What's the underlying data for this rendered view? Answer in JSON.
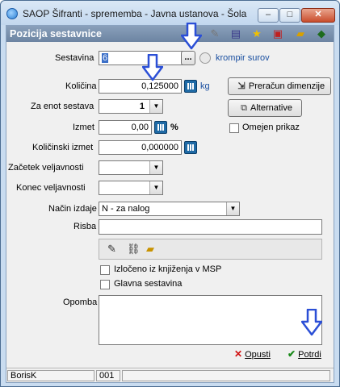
{
  "window": {
    "title": "SAOP Šifranti - sprememba - Javna ustanova - Šola",
    "min_symbol": "–",
    "max_symbol": "□",
    "close_symbol": "✕"
  },
  "header": {
    "title": "Pozicija sestavnice"
  },
  "form": {
    "sestavina_label": "Sestavina",
    "sestavina_value": "6",
    "sestavina_lookup": "...",
    "sestavina_name": "krompir surov",
    "kolicina_label": "Količina",
    "kolicina_value": "0,125000",
    "kolicina_unit": "kg",
    "za_enot_label": "Za enot sestava",
    "za_enot_value": "1",
    "izmet_label": "Izmet",
    "izmet_value": "0,00",
    "izmet_unit": "%",
    "kolicinski_izmet_label": "Količinski izmet",
    "kolicinski_izmet_value": "0,000000",
    "zacetek_label": "Začetek veljavnosti",
    "zacetek_value": "",
    "konec_label": "Konec veljavnosti",
    "konec_value": "",
    "nacin_label": "Način izdaje",
    "nacin_value": "N - za nalog",
    "risba_label": "Risba",
    "risba_value": "",
    "izloceno_label": "Izločeno iz knjiženja v MSP",
    "glavna_label": "Glavna sestavina",
    "opomba_label": "Opomba",
    "opomba_value": ""
  },
  "buttons": {
    "preracun": "Preračun dimenzije",
    "alternative": "Alternative",
    "omejen_prikaz": "Omejen prikaz",
    "opusti": "Opusti",
    "potrdi": "Potrdi"
  },
  "statusbar": {
    "user": "BorisK",
    "code": "001"
  },
  "colors": {
    "header": "#7a90ac",
    "arrow": "#2b4fd6",
    "link": "#1a4fa0"
  }
}
